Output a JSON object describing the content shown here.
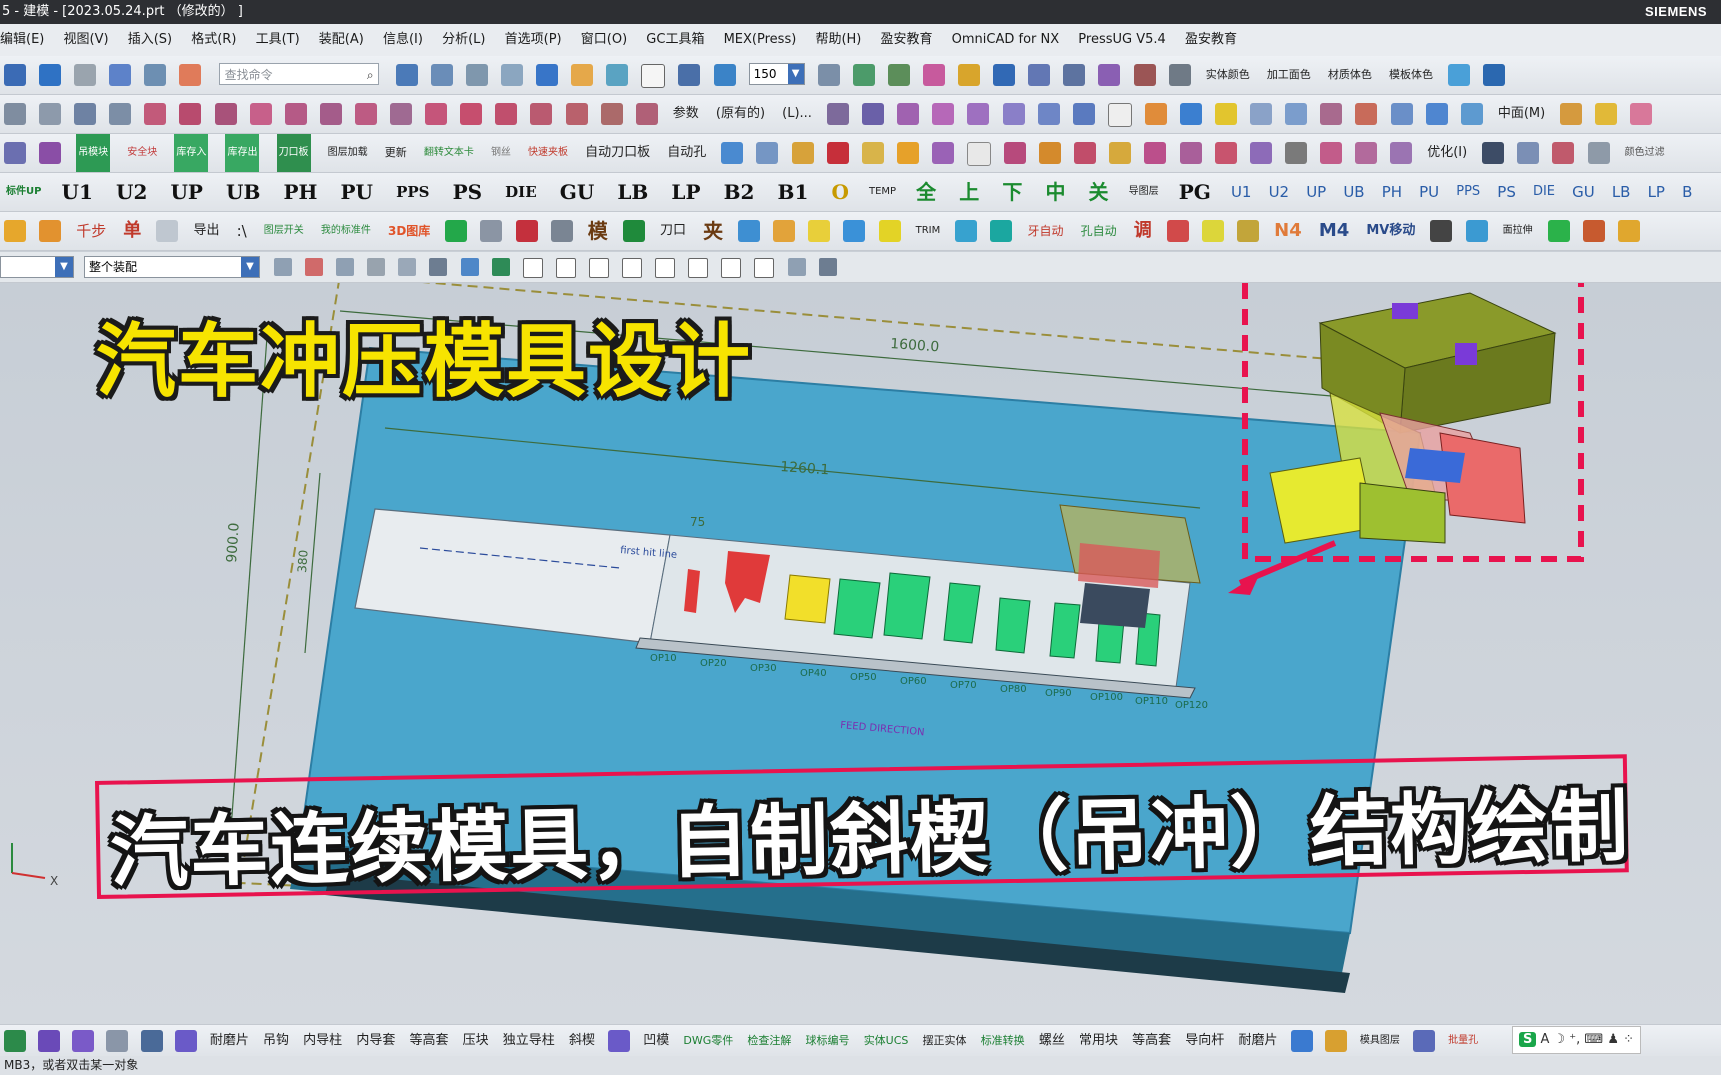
{
  "title_bar": {
    "title": "5 - 建模 - [2023.05.24.prt （修改的） ]",
    "brand": "SIEMENS"
  },
  "menu": [
    "编辑(E)",
    "视图(V)",
    "插入(S)",
    "格式(R)",
    "工具(T)",
    "装配(A)",
    "信息(I)",
    "分析(L)",
    "首选项(P)",
    "窗口(O)",
    "GC工具箱",
    "MEX(Press)",
    "帮助(H)",
    "盈安教育",
    "OmniCAD for NX",
    "PressUG V5.4",
    "盈安教育"
  ],
  "toolbar1": {
    "search_placeholder": "查找命令",
    "zoom": "150",
    "labels": [
      "实体颜色",
      "加工面色",
      "材质体色",
      "模板体色"
    ]
  },
  "toolbar2": {
    "labels": [
      "参数",
      "(原有的)",
      "(L)...",
      "中面(M)"
    ]
  },
  "toolbar3": {
    "labels": [
      "吊模块",
      "安全块",
      "库存入",
      "库存出",
      "刀口板",
      "图层加载",
      "更新",
      "翻转文本卡",
      "钢丝",
      "快速夹板",
      "自动刀口板",
      "自动孔",
      "优化(I)",
      "颜色过滤"
    ]
  },
  "toolbar4": {
    "labels": [
      "标件UP",
      "U1",
      "U2",
      "UP",
      "UB",
      "PH",
      "PU",
      "PPS",
      "PS",
      "DIE",
      "GU",
      "LB",
      "LP",
      "B2",
      "B1",
      "O",
      "TEMP",
      "全",
      "上",
      "下",
      "中",
      "关",
      "导图层",
      "PG",
      "U1",
      "U2",
      "UP",
      "UB",
      "PH",
      "PU",
      "PPS",
      "PS",
      "DIE",
      "GU",
      "LB",
      "LP",
      "B"
    ]
  },
  "toolbar5": {
    "labels": [
      "千步",
      "单",
      "导出",
      ":\\",
      "图层开关",
      "我的标准件",
      "3D图库",
      "模",
      "刀口",
      "夹",
      "TRIM",
      "牙自动",
      "孔自动",
      "调",
      "N4",
      "M4",
      "MV移动",
      "面拉伸"
    ]
  },
  "selection_bar": {
    "scope": "整个装配"
  },
  "overlay": {
    "headline": "汽车冲压模具设计",
    "banner": "汽车连续模具，自制斜楔（吊冲）结构绘制"
  },
  "drawing": {
    "dim_top": "1600.0",
    "dim_strip": "1260.1",
    "dim_left": "900.0",
    "dim_left_inner": "380",
    "dim_small": "75",
    "first_hit": "first hit line",
    "feed": "FEED DIRECTION",
    "stations": [
      "OP10",
      "OP20",
      "OP30",
      "OP40",
      "OP50",
      "OP60",
      "OP70",
      "OP80",
      "OP90",
      "OP100",
      "OP110",
      "OP120"
    ]
  },
  "bottom_bar": {
    "labels": [
      "耐磨片",
      "吊钩",
      "内导柱",
      "内导套",
      "等高套",
      "压块",
      "独立导柱",
      "斜楔",
      "凹模",
      "DWG零件",
      "检查注解",
      "球标编号",
      "实体UCS",
      "摆正实体",
      "标准转换",
      "螺丝",
      "常用块",
      "等高套",
      "导向杆",
      "耐磨片",
      "模具图层",
      "批量孔"
    ]
  },
  "status_bar": {
    "text": "MB3，或者双击某一对象"
  },
  "ime": {
    "label": "S",
    "text": "A ☽ ⁺, ⌨ ♟ ⁘"
  },
  "colors": {
    "plate": "#4aa6cc",
    "strip": "#e8ecef",
    "headline": "#f7e400",
    "banner_border": "#e8134e",
    "callout_border": "#e8134e"
  }
}
